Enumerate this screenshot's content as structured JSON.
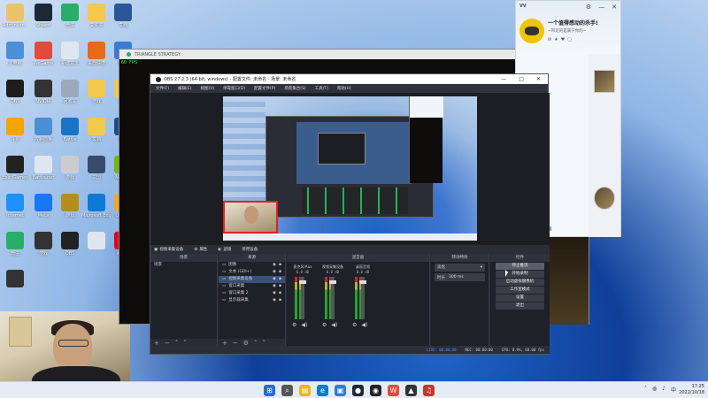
{
  "desktop": {
    "icons": [
      {
        "label": "Administr...",
        "icon": "user-folder-icon",
        "color": "#e9c46a"
      },
      {
        "label": "Steam",
        "icon": "steam-icon",
        "color": "#1b2838"
      },
      {
        "label": "微信",
        "icon": "wechat-icon",
        "color": "#2aae67"
      },
      {
        "label": "文件夹",
        "icon": "folder-icon",
        "color": "#f2c94c"
      },
      {
        "label": "文档",
        "icon": "word-icon",
        "color": "#2b5797"
      },
      {
        "label": "此电脑",
        "icon": "computer-icon",
        "color": "#4a90d9"
      },
      {
        "label": "WeGame",
        "icon": "wegame-icon",
        "color": "#e14b3b"
      },
      {
        "label": "新建文本",
        "icon": "text-file-icon",
        "color": "#dfe6ee"
      },
      {
        "label": "桌面快捷",
        "icon": "app-icon",
        "color": "#e86a17"
      },
      {
        "label": "网络",
        "icon": "network-icon",
        "color": "#3a7bd5"
      },
      {
        "label": "OBS",
        "icon": "obs-icon",
        "color": "#1d1d1d"
      },
      {
        "label": "NVIDIA",
        "icon": "nvidia-icon",
        "color": "#333"
      },
      {
        "label": "回收站",
        "icon": "recycle-bin-icon",
        "color": "#9ab"
      },
      {
        "label": "游戏",
        "icon": "folder-icon",
        "color": "#f2c94c"
      },
      {
        "label": "文件",
        "icon": "folder-icon",
        "color": "#f2c94c"
      },
      {
        "label": "斗鱼",
        "icon": "douyu-icon",
        "color": "#f6a400"
      },
      {
        "label": "控制面板",
        "icon": "control-panel-icon",
        "color": "#4a8fd6"
      },
      {
        "label": "Battle",
        "icon": "battlenet-icon",
        "color": "#1a73c4"
      },
      {
        "label": "文档",
        "icon": "folder-icon",
        "color": "#f2c94c"
      },
      {
        "label": "英雄",
        "icon": "game-icon",
        "color": "#1b4d8c"
      },
      {
        "label": "Epic Games",
        "icon": "epic-icon",
        "color": "#222"
      },
      {
        "label": "Battle.net",
        "icon": "text-file-icon",
        "color": "#dfe6ee"
      },
      {
        "label": "游戏",
        "icon": "game-icon",
        "color": "#ccc"
      },
      {
        "label": "三国",
        "icon": "game-icon",
        "color": "#384b6b"
      },
      {
        "label": "NVIDIA",
        "icon": "nvidia-icon",
        "color": "#76b900"
      },
      {
        "label": "Internet",
        "icon": "globe-icon",
        "color": "#1e90ff"
      },
      {
        "label": "Meta",
        "icon": "meta-icon",
        "color": "#1877f2"
      },
      {
        "label": "游戏",
        "icon": "game-icon",
        "color": "#b58d1e"
      },
      {
        "label": "Microsoft Edge",
        "icon": "edge-icon",
        "color": "#0c7bd4"
      },
      {
        "label": "UU加速",
        "icon": "uu-icon",
        "color": "#f5a623"
      },
      {
        "label": "微信",
        "icon": "wechat-icon",
        "color": "#2aae67"
      },
      {
        "label": "游戏",
        "icon": "game-icon",
        "color": "#333"
      },
      {
        "label": "OBS",
        "icon": "obs-icon",
        "color": "#222"
      },
      {
        "label": "",
        "icon": "text-file-icon",
        "color": "#dfe6ee"
      },
      {
        "label": "网易云",
        "icon": "netease-music-icon",
        "color": "#e60026"
      },
      {
        "label": "",
        "icon": "game-icon",
        "color": "#333"
      }
    ]
  },
  "game_window": {
    "title": "TRIANGLE STRATEGY",
    "fps": "60 FPS"
  },
  "qq": {
    "vv": "VV",
    "nickname": "一个值得感动的杀手!",
    "signature": "~带走的是属于你的~"
  },
  "obs": {
    "title": "OBS 27.2.3 (64-bit, windows) - 配置文件: 未命名 - 场景: 未命名",
    "menu": [
      "文件(F)",
      "编辑(E)",
      "视图(V)",
      "停靠窗口(D)",
      "配置文件(P)",
      "场景集合(S)",
      "工具(T)",
      "帮助(H)"
    ],
    "source_bar": {
      "current_source": "视频采集设备",
      "properties": "属性",
      "filters": "滤镜",
      "deactivate": "停用设备"
    },
    "scenes": {
      "header": "场景",
      "items": [
        "场景"
      ]
    },
    "sources": {
      "header": "来源",
      "items": [
        {
          "label": "图像",
          "selected": false
        },
        {
          "label": "文本 (GDI+)",
          "selected": false
        },
        {
          "label": "视频采集设备",
          "selected": true
        },
        {
          "label": "窗口采集",
          "selected": false
        },
        {
          "label": "窗口采集 2",
          "selected": false
        },
        {
          "label": "显示器采集",
          "selected": false
        }
      ]
    },
    "mixer": {
      "header": "混音器",
      "channels": [
        {
          "name": "麦克风/Aux",
          "db": "0.0 dB"
        },
        {
          "name": "视频采集设备",
          "db": "0.0 dB"
        },
        {
          "name": "桌面音频",
          "db": "0.0 dB"
        }
      ]
    },
    "transitions": {
      "header": "转场特效",
      "type": "淡化",
      "duration_label": "时长",
      "duration": "300 ms"
    },
    "controls": {
      "header": "控件",
      "buttons": [
        {
          "label": "停止推流",
          "active": true
        },
        {
          "label": "开始录制",
          "active": false
        },
        {
          "label": "启动虚拟摄像机",
          "active": false
        },
        {
          "label": "工作室模式",
          "active": false
        },
        {
          "label": "设置",
          "active": false
        },
        {
          "label": "退出",
          "active": false
        }
      ]
    },
    "status": {
      "live": "LIVE: 00:00:00",
      "rec": "REC: 00:00:00",
      "cpu": "CPU: 0.9%, 60.00 fps"
    }
  },
  "taskbar": {
    "apps": [
      {
        "icon": "windows-start-icon",
        "color": "#1e6fd9"
      },
      {
        "icon": "search-icon",
        "color": "#555"
      },
      {
        "icon": "file-explorer-icon",
        "color": "#e8b622"
      },
      {
        "icon": "edge-icon",
        "color": "#0c7bd4"
      },
      {
        "icon": "microsoft-store-icon",
        "color": "#2d7dd2"
      },
      {
        "icon": "steam-icon",
        "color": "#1b2838"
      },
      {
        "icon": "obs-icon",
        "color": "#222"
      },
      {
        "icon": "wegame-icon",
        "color": "#e14b3b"
      },
      {
        "icon": "game-icon",
        "color": "#333"
      },
      {
        "icon": "netease-music-icon",
        "color": "#c0392b"
      }
    ],
    "time": "17:25",
    "date": "2022/10/18"
  }
}
